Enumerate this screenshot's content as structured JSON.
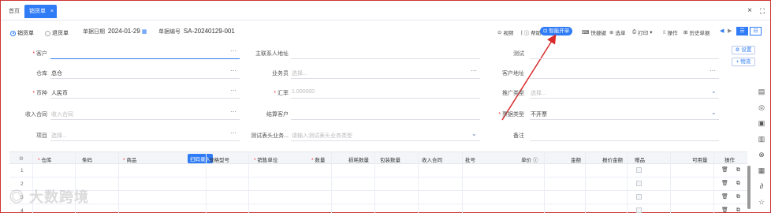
{
  "tabs": {
    "home": "首页",
    "active": "销货单",
    "close": "×"
  },
  "window": {
    "close": "×",
    "maximize": "⛶"
  },
  "toolbar": {
    "radio_sale": "销货单",
    "radio_return": "退货单",
    "date_label": "单据日期",
    "date_value": "2024-01-29",
    "code_label": "单据编号",
    "code_value": "SA-20240129-001",
    "video": "视频",
    "help": "帮助",
    "smart": "智能开单",
    "shortcut": "快捷键",
    "select": "选单",
    "print": "打印",
    "ops": "操作",
    "history": "历史单据"
  },
  "form": {
    "customer_label": "客户",
    "contact_label": "主联系人地址",
    "test_label": "测试",
    "warehouse_label": "仓库",
    "warehouse_value": "总仓",
    "salesman_label": "业务员",
    "salesman_ph": "选择...",
    "customer_addr_label": "客户地址",
    "currency_label": "币种",
    "currency_value": "人民币",
    "rate_label": "汇率",
    "rate_value": "1.000000",
    "promo_label": "推广类型",
    "promo_ph": "选择...",
    "contract_label": "收入合同",
    "contract_ph": "收入合同",
    "settle_label": "结算客户",
    "invoice_label": "票据类型",
    "invoice_value": "不开票",
    "project_label": "项目",
    "project_ph": "选择...",
    "test_biz_label": "测试表头业务...",
    "test_biz_ph": "请输入测试表头业务类型",
    "remark_label": "备注"
  },
  "side_buttons": {
    "settings": "设置",
    "add": "+ 物流"
  },
  "table": {
    "columns": [
      "仓库",
      "条码",
      "商品",
      "规格型号",
      "销售单位",
      "数量",
      "损耗数量",
      "包装数量",
      "收入合同",
      "批号",
      "单价",
      "金额",
      "报价金额",
      "赠品",
      "可用量",
      "操作"
    ],
    "scan_label": "扫码录入",
    "rows": [
      "1",
      "2",
      "3",
      "4"
    ],
    "row_ops": "🗑 ⧉"
  },
  "watermark": "大数跨境",
  "colors": {
    "primary": "#2f7cf6",
    "required": "#e33333",
    "annotation": "#d92b2b"
  }
}
